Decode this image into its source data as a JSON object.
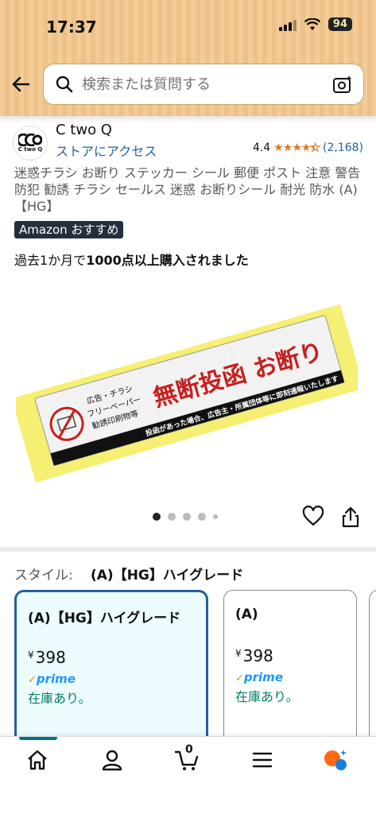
{
  "status_bar": {
    "time": "17:37",
    "battery": "94"
  },
  "search": {
    "placeholder": "検索または質問する"
  },
  "brand": {
    "name": "C two Q",
    "logo_text": "C two Q",
    "store_link": "ストアにアクセス"
  },
  "rating": {
    "value": "4.4",
    "stars": 4.4,
    "count": "(2,168)"
  },
  "product": {
    "title": "迷惑チラシ お断り ステッカー シール 郵便 ポスト 注意 警告 防犯 勧誘 チラシ セールス 迷惑 お断りシール 耐光 防水 (A)【HG】",
    "badge": "Amazon おすすめ",
    "bought_prefix": "過去1か月で",
    "bought_bold": "1000点以上購入されました",
    "image": {
      "main_text": "無断投函 お断り",
      "left_lines": [
        "広告・チラシ",
        "フリーペーパー",
        "勧誘印刷物等"
      ],
      "bottom_text": "投函があった場合、広告主・所属団体等に即刻通報いたします"
    }
  },
  "carousel": {
    "count": 5,
    "active": 1
  },
  "style": {
    "label": "スタイル:",
    "selected": "(A)【HG】ハイグレード",
    "options": [
      {
        "name": "(A)【HG】ハイグレード",
        "currency": "¥",
        "price": "398",
        "prime": "prime",
        "stock": "在庫あり。"
      },
      {
        "name": "(A)",
        "currency": "¥",
        "price": "398",
        "prime": "prime",
        "stock": "在庫あり。"
      }
    ]
  },
  "nav": {
    "cart_count": "0",
    "items": [
      "home-icon",
      "account-icon",
      "cart-icon",
      "menu-icon",
      "rufus-icon"
    ]
  },
  "colors": {
    "header_bg": "#f2c58b",
    "link": "#2162a1",
    "star": "#de7921",
    "stock": "#067d62",
    "prime": "#1a98ff",
    "selected_border": "#2162a1"
  }
}
